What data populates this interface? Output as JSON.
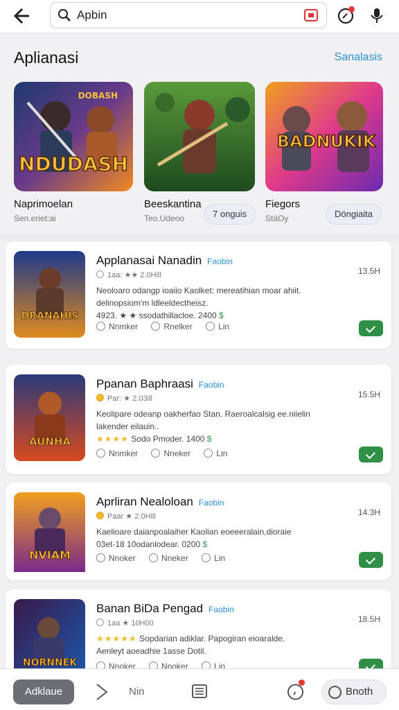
{
  "header": {
    "search_value": "Apbin"
  },
  "section": {
    "title": "Aplianasi",
    "link": "Sanalasis"
  },
  "featured": [
    {
      "name": "Naprimoelan",
      "sub": "Sen.eriet:ai",
      "badge": "NDUDASH",
      "badge_sub": "DOBASH"
    },
    {
      "name": "Beeskantina",
      "sub": "Teo.Udeoo",
      "pill": "7 onguis"
    },
    {
      "name": "Fiegors",
      "sub": "StäOy",
      "pill": "Döngiaita",
      "badge": "BADNUKIK"
    }
  ],
  "list": [
    {
      "title": "Applanasai Nanadin",
      "tag": "Faobin",
      "size": "13.5H",
      "meta": "1aa: ★★ 2.0Hill",
      "desc1": "Neoloaro odangp ioaiio Kaolket: mereatihian moar ahiit.",
      "desc2": "delinopsiom'm ldleeldectheisz.",
      "desc3": "4923. ★ ★ ssodathillacloe. 2400",
      "opt1": "Nnmker",
      "opt2": "Rnelker",
      "opt3": "Lin",
      "art": "DRANAHIS"
    },
    {
      "title": "Ppanan Baphraasi",
      "tag": "Faobin",
      "size": "15.5H",
      "meta": "Par: ★ 2.03ill",
      "desc1": "Keolipare odeanp oakherfao Stan. Raeroalcalsig ee.niielin",
      "desc2": "lakender eilauin..",
      "stars": "★★★★",
      "desc3": "Sodo Pmoder. 1400",
      "opt1": "Nnmker",
      "opt2": "Nneker",
      "opt3": "Lin",
      "art": "AUNHA"
    },
    {
      "title": "Aprliran Nealoloan",
      "tag": "Faobin",
      "size": "14.3H",
      "meta": "Paar ★ 2.0Hill",
      "desc1": "Kaelioare daianpoalaiher Kaolian eoeeeralain,dioraie",
      "desc2": "03et-18 10odanlodear. 0200",
      "opt1": "Nnoker",
      "opt2": "Nneker",
      "opt3": "Lin",
      "art": "NVIAM"
    },
    {
      "title": "Banan BiDa Pengad",
      "tag": "Faobin",
      "size": "18.5H",
      "meta": "1aa ★ 10H00",
      "stars": "★★★★★",
      "desc1": "Sopdarian adiklar. Papogiran eioaralde.",
      "desc2": "Aenleyt aoeadhie 1asse Dotil.",
      "opt1": "Nnoker",
      "opt2": "Nnoker",
      "opt3": "Lin",
      "art": "NORNNEK"
    }
  ],
  "bottom": {
    "left_button": "Adklaue",
    "label": "Nin",
    "right_button": "Bnoth"
  }
}
